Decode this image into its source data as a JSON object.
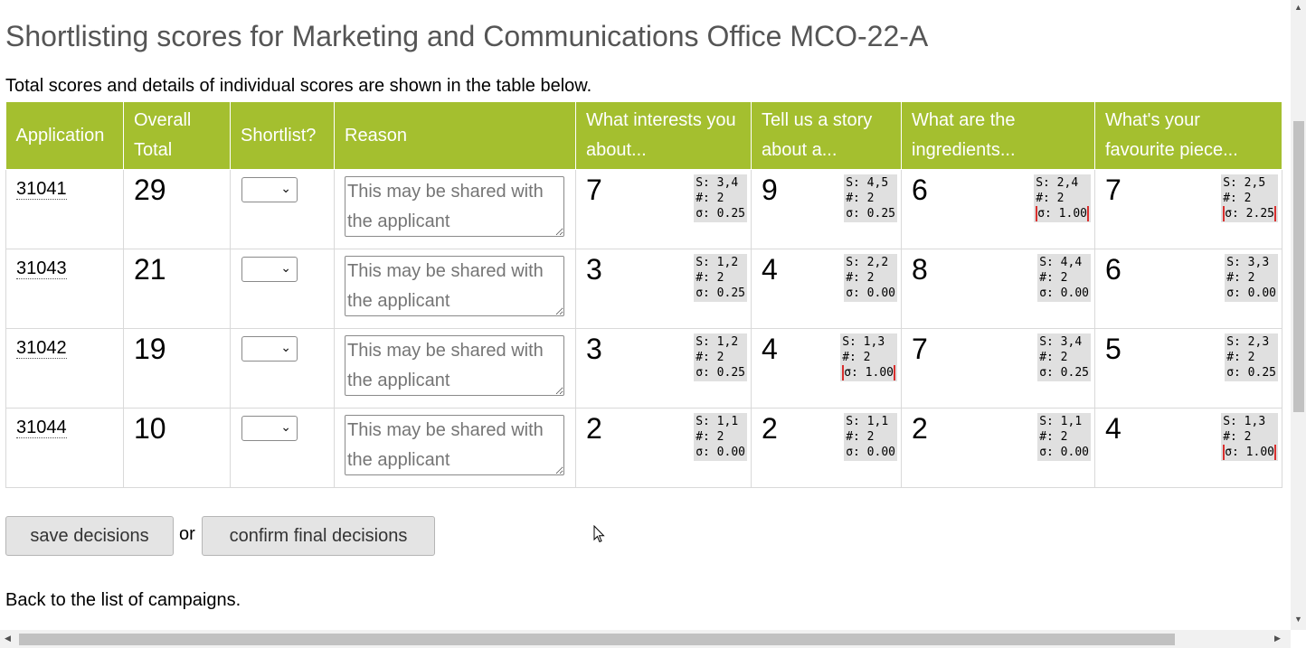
{
  "title": "Shortlisting scores for Marketing and Communications Office MCO-22-A",
  "intro": "Total scores and details of individual scores are shown in the table below.",
  "headers": {
    "application": "Application",
    "overall_total": "Overall Total",
    "shortlist": "Shortlist?",
    "reason": "Reason",
    "q1": "What interests you about...",
    "q2": "Tell us a story about a...",
    "q3": "What are the ingredients...",
    "q4": "What's your favourite piece..."
  },
  "reason_placeholder": "This may be shared with the applicant",
  "rows": [
    {
      "id": "31041",
      "total": "29",
      "q": [
        {
          "score": "7",
          "s": "S: 3,4",
          "n": "#: 2",
          "sd": "σ: 0.25",
          "high_variance": false
        },
        {
          "score": "9",
          "s": "S: 4,5",
          "n": "#: 2",
          "sd": "σ: 0.25",
          "high_variance": false
        },
        {
          "score": "6",
          "s": "S: 2,4",
          "n": "#: 2",
          "sd": "σ: 1.00",
          "high_variance": true
        },
        {
          "score": "7",
          "s": "S: 2,5",
          "n": "#: 2",
          "sd": "σ: 2.25",
          "high_variance": true
        }
      ]
    },
    {
      "id": "31043",
      "total": "21",
      "q": [
        {
          "score": "3",
          "s": "S: 1,2",
          "n": "#: 2",
          "sd": "σ: 0.25",
          "high_variance": false
        },
        {
          "score": "4",
          "s": "S: 2,2",
          "n": "#: 2",
          "sd": "σ: 0.00",
          "high_variance": false
        },
        {
          "score": "8",
          "s": "S: 4,4",
          "n": "#: 2",
          "sd": "σ: 0.00",
          "high_variance": false
        },
        {
          "score": "6",
          "s": "S: 3,3",
          "n": "#: 2",
          "sd": "σ: 0.00",
          "high_variance": false
        }
      ]
    },
    {
      "id": "31042",
      "total": "19",
      "q": [
        {
          "score": "3",
          "s": "S: 1,2",
          "n": "#: 2",
          "sd": "σ: 0.25",
          "high_variance": false
        },
        {
          "score": "4",
          "s": "S: 1,3",
          "n": "#: 2",
          "sd": "σ: 1.00",
          "high_variance": true
        },
        {
          "score": "7",
          "s": "S: 3,4",
          "n": "#: 2",
          "sd": "σ: 0.25",
          "high_variance": false
        },
        {
          "score": "5",
          "s": "S: 2,3",
          "n": "#: 2",
          "sd": "σ: 0.25",
          "high_variance": false
        }
      ]
    },
    {
      "id": "31044",
      "total": "10",
      "q": [
        {
          "score": "2",
          "s": "S: 1,1",
          "n": "#: 2",
          "sd": "σ: 0.00",
          "high_variance": false
        },
        {
          "score": "2",
          "s": "S: 1,1",
          "n": "#: 2",
          "sd": "σ: 0.00",
          "high_variance": false
        },
        {
          "score": "2",
          "s": "S: 1,1",
          "n": "#: 2",
          "sd": "σ: 0.00",
          "high_variance": false
        },
        {
          "score": "4",
          "s": "S: 1,3",
          "n": "#: 2",
          "sd": "σ: 1.00",
          "high_variance": true
        }
      ]
    }
  ],
  "buttons": {
    "save": "save decisions",
    "or": "or",
    "confirm": "confirm final decisions"
  },
  "back_link": "Back to the list of campaigns.",
  "colors": {
    "header_bg": "#a4bf2f",
    "title": "#555555",
    "stats_bg": "#e0e0e0",
    "variance_flag": "#d9302f"
  },
  "icons": {
    "select_chevron": "chevron-down-icon",
    "cursor": "mouse-pointer-icon"
  }
}
